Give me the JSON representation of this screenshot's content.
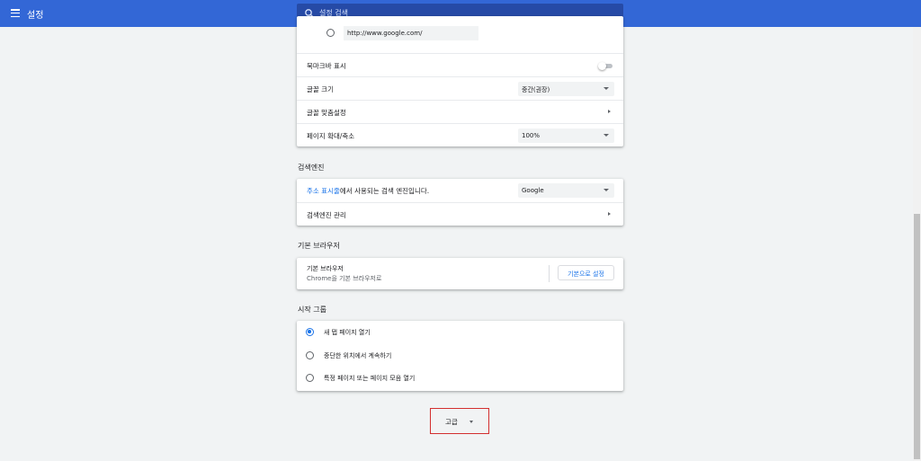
{
  "header": {
    "title": "설정",
    "search_placeholder": "설정 검색"
  },
  "appearance": {
    "homepage_url": "http://www.google.com/",
    "rows": {
      "bookmarks_bar": "북마크바 표시",
      "font_size": "글꼴 크기",
      "font_size_value": "중간(권장)",
      "customize_fonts": "글꼴 맞춤설정",
      "page_zoom": "페이지 확대/축소",
      "page_zoom_value": "100%"
    },
    "bookmarks_bar_enabled": false
  },
  "search_engine": {
    "section_title": "검색엔진",
    "description_link": "주소 표시줄",
    "description_rest": "에서 사용되는 검색 엔진입니다.",
    "selected": "Google",
    "manage_label": "검색엔진 관리"
  },
  "default_browser": {
    "section_title": "기본 브라우저",
    "title": "기본 브라우저",
    "subtitle": "Chrome을 기본 브라우저로",
    "button_label": "기본으로 설정"
  },
  "on_startup": {
    "section_title": "시작 그룹",
    "options": [
      {
        "label": "새 탭 페이지 열기",
        "checked": true
      },
      {
        "label": "중단한 위치에서 계속하기",
        "checked": false
      },
      {
        "label": "특정 페이지 또는 페이지 모음 열기",
        "checked": false
      }
    ]
  },
  "advanced": {
    "label": "고급"
  },
  "colors": {
    "header_bg": "#3367d6",
    "accent": "#1a73e8",
    "highlight_border": "#d32f2f"
  }
}
